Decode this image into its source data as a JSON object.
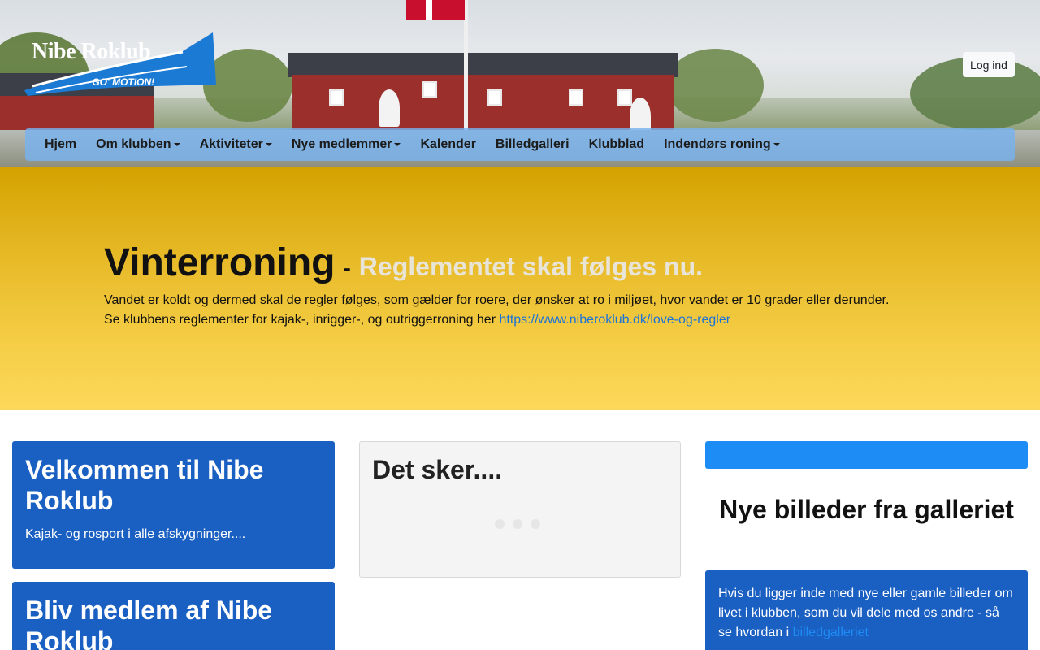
{
  "header": {
    "logo": {
      "name": "Nibe Roklub",
      "tagline": "- GO' MOTION!"
    },
    "login_label": "Log ind"
  },
  "nav": {
    "items": [
      {
        "label": "Hjem",
        "dropdown": false
      },
      {
        "label": "Om klubben",
        "dropdown": true
      },
      {
        "label": "Aktiviteter",
        "dropdown": true
      },
      {
        "label": "Nye medlemmer",
        "dropdown": true
      },
      {
        "label": "Kalender",
        "dropdown": false
      },
      {
        "label": "Billedgalleri",
        "dropdown": false
      },
      {
        "label": "Klubblad",
        "dropdown": false
      },
      {
        "label": "Indendørs roning",
        "dropdown": true
      }
    ]
  },
  "alert": {
    "title": "Vinterroning",
    "dash": "-",
    "subtitle": "Reglementet skal følges nu.",
    "line1": "Vandet er koldt og dermed skal de regler følges, som gælder for roere, der ønsker at ro i miljøet, hvor vandet er 10 grader eller derunder.",
    "line2_prefix": "Se klubbens reglementer for kajak-, inrigger-, og outriggerroning her ",
    "link": "https://www.niberoklub.dk/love-og-regler"
  },
  "welcome": {
    "title": "Velkommen til Nibe Roklub",
    "text": "Kajak- og rosport i alle afskygninger...."
  },
  "member": {
    "title": "Bliv medlem af Nibe Roklub"
  },
  "events": {
    "title": "Det sker...."
  },
  "gallery": {
    "title": "Nye billeder fra galleriet",
    "text": "Hvis du ligger inde med nye eller gamle billeder om livet i klubben, som du vil dele med os andre - så se hvordan i ",
    "link": "billedgalleriet"
  },
  "colors": {
    "nav_bg": "#78b2ee",
    "band_top": "#d4a200",
    "band_bottom": "#fcd85a",
    "card_blue": "#1a5fc2",
    "accent_blue": "#1e8cf5"
  }
}
